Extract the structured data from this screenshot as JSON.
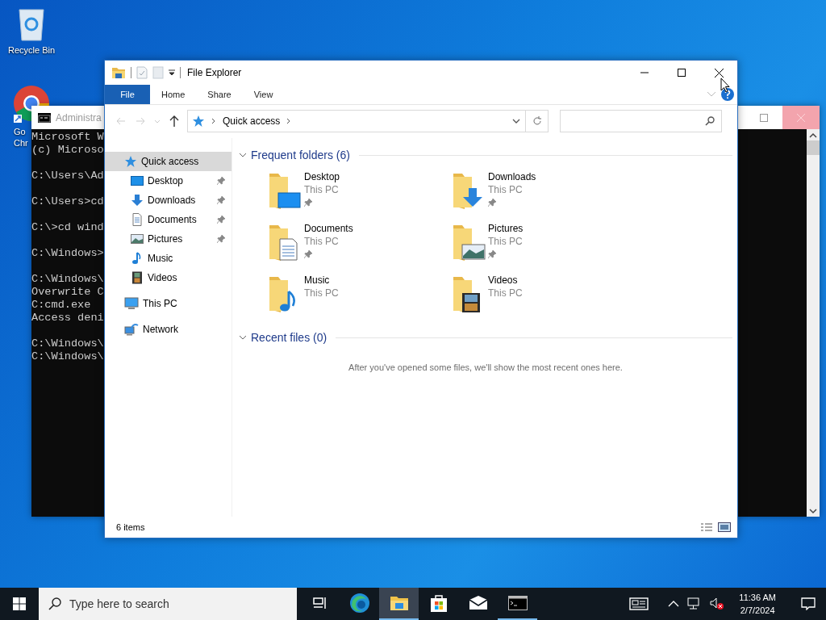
{
  "desktop_icons": [
    {
      "kind": "recycle-bin",
      "lines": [
        "Recycle Bin"
      ]
    },
    {
      "kind": "browser",
      "lines": [
        "Go",
        "Chr"
      ]
    }
  ],
  "console_window": {
    "title": "Administra",
    "blocks": [
      [
        "Microsoft W",
        "(c) Microso"
      ],
      [
        "C:\\Users\\Ad"
      ],
      [
        "C:\\Users>cd"
      ],
      [
        "C:\\>cd wind"
      ],
      [
        "C:\\Windows>"
      ],
      [
        "C:\\Windows\\",
        "Overwrite C",
        "C:cmd.exe",
        "Access deni"
      ],
      [
        "C:\\Windows\\",
        "C:\\Windows\\"
      ]
    ]
  },
  "explorer": {
    "title": "File Explorer",
    "ribbon_tabs": [
      {
        "label": "File",
        "kind": "menu"
      },
      {
        "label": "Home",
        "kind": "tab"
      },
      {
        "label": "Share",
        "kind": "tab"
      },
      {
        "label": "View",
        "kind": "tab"
      }
    ],
    "address": {
      "path": "Quick access"
    },
    "nav": [
      {
        "label": "Quick access",
        "kind": "star",
        "selected": true,
        "children": [
          {
            "label": "Desktop",
            "kind": "desktop",
            "selected": false,
            "pinned": true
          },
          {
            "label": "Downloads",
            "kind": "downloads",
            "selected": false,
            "pinned": true
          },
          {
            "label": "Documents",
            "kind": "documents",
            "selected": false,
            "pinned": true
          },
          {
            "label": "Pictures",
            "kind": "pictures",
            "selected": false,
            "pinned": true
          },
          {
            "label": "Music",
            "kind": "music",
            "selected": false,
            "pinned": false
          },
          {
            "label": "Videos",
            "kind": "videos",
            "selected": false,
            "pinned": false
          }
        ]
      },
      {
        "label": "This PC",
        "kind": "pc",
        "selected": false
      },
      {
        "label": "Network",
        "kind": "network",
        "selected": false
      }
    ],
    "frequent_folders": {
      "title": "Frequent folders (6)",
      "expanded": true,
      "items": [
        {
          "name": "Desktop",
          "location": "This PC",
          "kind": "desktop",
          "pinned": true
        },
        {
          "name": "Downloads",
          "location": "This PC",
          "kind": "downloads",
          "pinned": true
        },
        {
          "name": "Documents",
          "location": "This PC",
          "kind": "documents",
          "pinned": true
        },
        {
          "name": "Pictures",
          "location": "This PC",
          "kind": "pictures",
          "pinned": true
        },
        {
          "name": "Music",
          "location": "This PC",
          "kind": "music",
          "pinned": false
        },
        {
          "name": "Videos",
          "location": "This PC",
          "kind": "videos",
          "pinned": false
        }
      ]
    },
    "recent_files": {
      "title": "Recent files (0)",
      "expanded": true,
      "message": "After you've opened some files, we'll show the most recent ones here."
    },
    "status_bar": {
      "item_count": "6 items"
    }
  },
  "taskbar": {
    "search_placeholder": "Type here to search",
    "apps": [
      {
        "kind": "task-view",
        "active": false,
        "running": false
      },
      {
        "kind": "browser",
        "active": false,
        "running": false
      },
      {
        "kind": "explorer",
        "active": true,
        "running": true
      },
      {
        "kind": "store",
        "active": false,
        "running": false
      },
      {
        "kind": "mail",
        "active": false,
        "running": false
      },
      {
        "kind": "console",
        "active": false,
        "running": true
      }
    ],
    "time": "11:36 AM",
    "date": "2/7/2024"
  }
}
